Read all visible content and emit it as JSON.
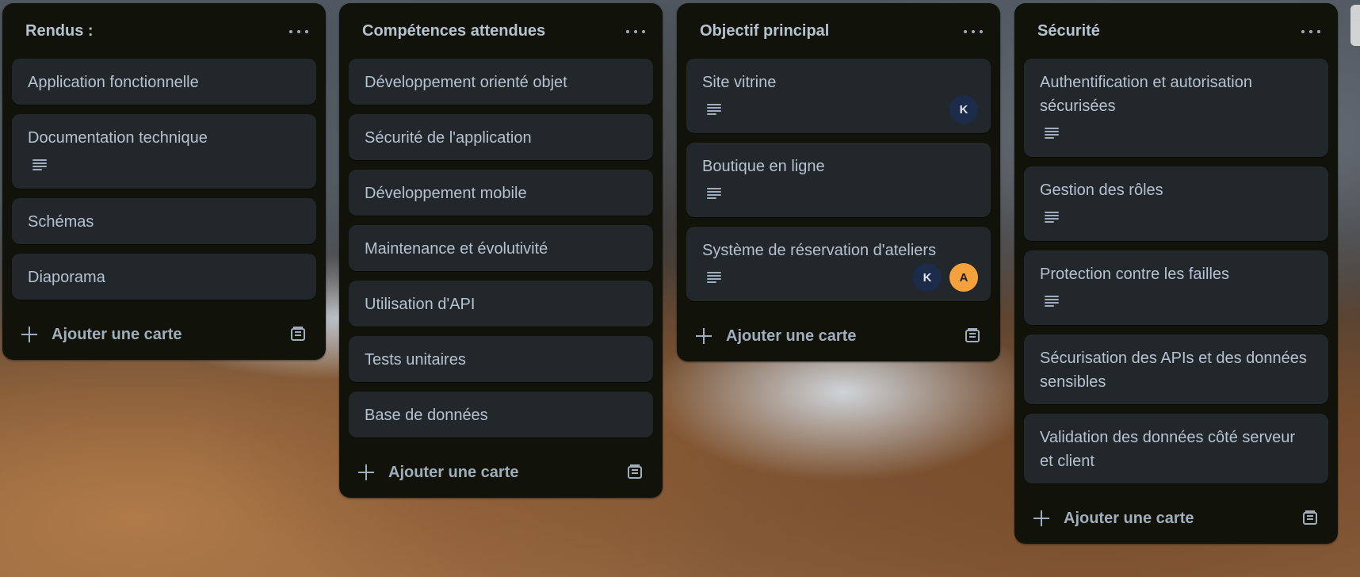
{
  "lists": [
    {
      "title": "Rendus :",
      "cards": [
        {
          "title": "Application fonctionnelle",
          "has_description": false,
          "members": []
        },
        {
          "title": "Documentation technique",
          "has_description": true,
          "members": []
        },
        {
          "title": "Schémas",
          "has_description": false,
          "members": []
        },
        {
          "title": "Diaporama",
          "has_description": false,
          "members": []
        }
      ],
      "add_label": "Ajouter une carte"
    },
    {
      "title": "Compétences attendues",
      "cards": [
        {
          "title": "Développement orienté objet",
          "has_description": false,
          "members": []
        },
        {
          "title": "Sécurité de l'application",
          "has_description": false,
          "members": []
        },
        {
          "title": "Développement mobile",
          "has_description": false,
          "members": []
        },
        {
          "title": "Maintenance et évolutivité",
          "has_description": false,
          "members": []
        },
        {
          "title": "Utilisation d'API",
          "has_description": false,
          "members": []
        },
        {
          "title": "Tests unitaires",
          "has_description": false,
          "members": []
        },
        {
          "title": "Base de données",
          "has_description": false,
          "members": []
        }
      ],
      "add_label": "Ajouter une carte"
    },
    {
      "title": "Objectif principal",
      "cards": [
        {
          "title": "Site vitrine",
          "has_description": true,
          "members": [
            "K"
          ]
        },
        {
          "title": "Boutique en ligne",
          "has_description": true,
          "members": []
        },
        {
          "title": "Système de réservation d'ateliers",
          "has_description": true,
          "members": [
            "K",
            "A"
          ]
        }
      ],
      "add_label": "Ajouter une carte"
    },
    {
      "title": "Sécurité",
      "cards": [
        {
          "title": "Authentification et autorisation sécurisées",
          "has_description": true,
          "members": []
        },
        {
          "title": "Gestion des rôles",
          "has_description": true,
          "members": []
        },
        {
          "title": "Protection contre les failles",
          "has_description": true,
          "members": []
        },
        {
          "title": "Sécurisation des APIs et des données sensibles",
          "has_description": false,
          "members": []
        },
        {
          "title": "Validation des données côté serveur et client",
          "has_description": false,
          "members": []
        }
      ],
      "add_label": "Ajouter une carte"
    }
  ],
  "colors": {
    "list_bg": "#111209",
    "card_bg": "#22272b",
    "text": "#b6c2cf",
    "avatar_k": "#1c2b4a",
    "avatar_a": "#f5a23c"
  },
  "icons": {
    "menu": "ellipsis-icon",
    "description": "description-lines-icon",
    "add": "plus-icon",
    "template": "card-template-icon"
  }
}
